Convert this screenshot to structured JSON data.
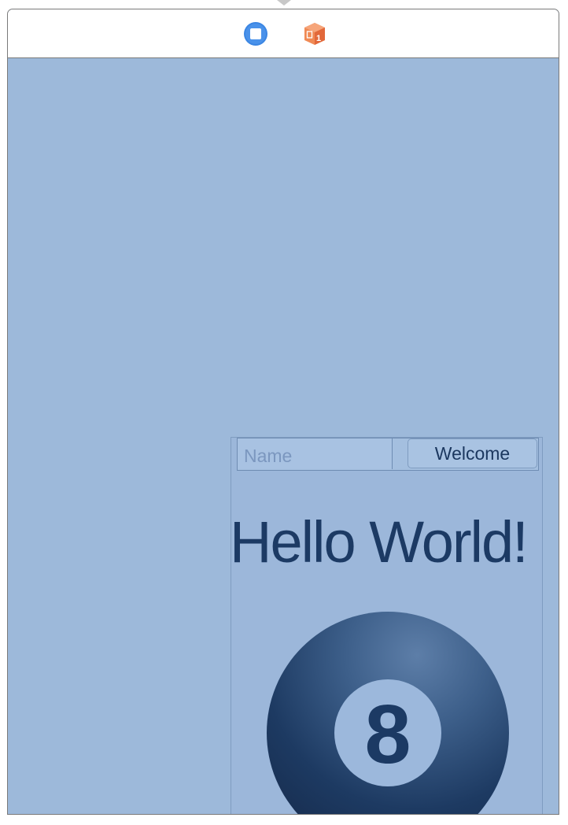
{
  "toolbar": {
    "icons": [
      "view-controller-icon",
      "first-responder-icon"
    ]
  },
  "form": {
    "name_placeholder": "Name",
    "name_value": "",
    "welcome_label": "Welcome"
  },
  "main": {
    "hello_label": "Hello World!",
    "ball_number": "8"
  },
  "colors": {
    "canvas": "#9db9da",
    "text_dark": "#1c3a64",
    "ball_dark": "#1a3154",
    "view_controller_icon": "#3a84e0",
    "responder_icon": "#ee7b47"
  }
}
